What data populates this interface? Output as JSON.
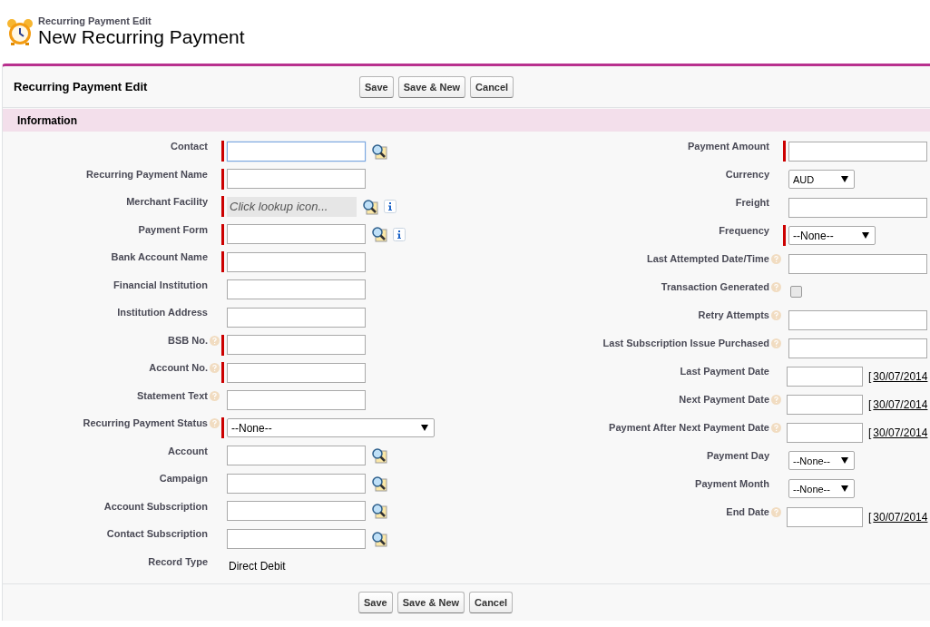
{
  "page": {
    "breadcrumb": "Recurring Payment Edit",
    "title": "New Recurring Payment"
  },
  "block": {
    "title": "Recurring Payment Edit",
    "buttons": [
      "Save",
      "Save & New",
      "Cancel"
    ],
    "footer_buttons": [
      "Save",
      "Save & New",
      "Cancel"
    ]
  },
  "section": {
    "title": "Information"
  },
  "left_fields": [
    {
      "label": "Contact",
      "kind": "lookup",
      "required": true,
      "help": false,
      "focused": true
    },
    {
      "label": "Recurring Payment Name",
      "kind": "text",
      "required": true,
      "help": false
    },
    {
      "label": "Merchant Facility",
      "kind": "lookup",
      "required": true,
      "help": false,
      "disabled": true,
      "placeholder": "Click lookup icon...",
      "info": true
    },
    {
      "label": "Payment Form",
      "kind": "lookup",
      "required": true,
      "help": false,
      "info": true
    },
    {
      "label": "Bank Account Name",
      "kind": "text",
      "required": true,
      "help": false
    },
    {
      "label": "Financial Institution",
      "kind": "text",
      "required": false,
      "help": false
    },
    {
      "label": "Institution Address",
      "kind": "text",
      "required": false,
      "help": false
    },
    {
      "label": "BSB No.",
      "kind": "text",
      "required": true,
      "help": true
    },
    {
      "label": "Account No.",
      "kind": "text",
      "required": true,
      "help": true
    },
    {
      "label": "Statement Text",
      "kind": "text",
      "required": false,
      "help": true
    },
    {
      "label": "Recurring Payment Status",
      "kind": "select",
      "required": true,
      "help": true,
      "value": "--None--"
    },
    {
      "label": "Account",
      "kind": "lookup",
      "required": false,
      "help": false
    },
    {
      "label": "Campaign",
      "kind": "lookup",
      "required": false,
      "help": false
    },
    {
      "label": "Account Subscription",
      "kind": "lookup",
      "required": false,
      "help": false
    },
    {
      "label": "Contact Subscription",
      "kind": "lookup",
      "required": false,
      "help": false
    },
    {
      "label": "Record Type",
      "kind": "readonly",
      "required": false,
      "help": false,
      "value": "Direct Debit"
    }
  ],
  "right_fields": [
    {
      "label": "Payment Amount",
      "kind": "text",
      "required": true,
      "help": false
    },
    {
      "label": "Currency",
      "kind": "select",
      "required": false,
      "help": false,
      "value": "AUD"
    },
    {
      "label": "Freight",
      "kind": "text",
      "required": false,
      "help": false
    },
    {
      "label": "Frequency",
      "kind": "select",
      "required": true,
      "help": false,
      "value": "--None--"
    },
    {
      "label": "Last Attempted Date/Time",
      "kind": "text",
      "required": false,
      "help": true
    },
    {
      "label": "Transaction Generated",
      "kind": "checkbox",
      "required": false,
      "help": true,
      "checked": false
    },
    {
      "label": "Retry Attempts",
      "kind": "text",
      "required": false,
      "help": true
    },
    {
      "label": "Last Subscription Issue Purchased",
      "kind": "text",
      "required": false,
      "help": true
    },
    {
      "label": "Last Payment Date",
      "kind": "date",
      "required": false,
      "help": false,
      "bracket": "[",
      "today": "30/07/2014"
    },
    {
      "label": "Next Payment Date",
      "kind": "date",
      "required": false,
      "help": true,
      "bracket": "[",
      "today": "30/07/2014"
    },
    {
      "label": "Payment After Next Payment Date",
      "kind": "date",
      "required": false,
      "help": true,
      "bracket": "[",
      "today": "30/07/2014"
    },
    {
      "label": "Payment Day",
      "kind": "select",
      "required": false,
      "help": false,
      "value": "--None--"
    },
    {
      "label": "Payment Month",
      "kind": "select",
      "required": false,
      "help": false,
      "value": "--None--"
    },
    {
      "label": "End Date",
      "kind": "date",
      "required": false,
      "help": true,
      "bracket": "[",
      "today": "30/07/2014"
    }
  ]
}
